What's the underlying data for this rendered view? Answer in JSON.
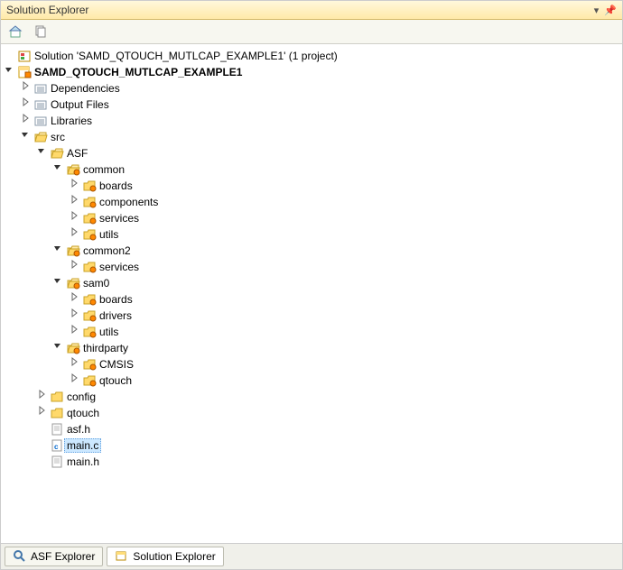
{
  "title": "Solution Explorer",
  "tabs": {
    "asf_explorer": "ASF Explorer",
    "solution_explorer": "Solution Explorer"
  },
  "tree": [
    {
      "depth": 0,
      "exp": "open",
      "icon": "solution",
      "label": "Solution 'SAMD_QTOUCH_MUTLCAP_EXAMPLE1' (1 project)",
      "bold": false,
      "sel": false,
      "hideExp": true
    },
    {
      "depth": 0,
      "exp": "open",
      "icon": "project",
      "label": "SAMD_QTOUCH_MUTLCAP_EXAMPLE1",
      "bold": true,
      "sel": false
    },
    {
      "depth": 1,
      "exp": "closed",
      "icon": "ref",
      "label": "Dependencies",
      "bold": false,
      "sel": false
    },
    {
      "depth": 1,
      "exp": "closed",
      "icon": "ref",
      "label": "Output Files",
      "bold": false,
      "sel": false
    },
    {
      "depth": 1,
      "exp": "closed",
      "icon": "ref",
      "label": "Libraries",
      "bold": false,
      "sel": false
    },
    {
      "depth": 1,
      "exp": "open",
      "icon": "folder-open",
      "label": "src",
      "bold": false,
      "sel": false
    },
    {
      "depth": 2,
      "exp": "open",
      "icon": "folder-open",
      "label": "ASF",
      "bold": false,
      "sel": false
    },
    {
      "depth": 3,
      "exp": "open",
      "icon": "folder-open-badge",
      "label": "common",
      "bold": false,
      "sel": false
    },
    {
      "depth": 4,
      "exp": "closed",
      "icon": "folder-badge",
      "label": "boards",
      "bold": false,
      "sel": false
    },
    {
      "depth": 4,
      "exp": "closed",
      "icon": "folder-badge",
      "label": "components",
      "bold": false,
      "sel": false
    },
    {
      "depth": 4,
      "exp": "closed",
      "icon": "folder-badge",
      "label": "services",
      "bold": false,
      "sel": false
    },
    {
      "depth": 4,
      "exp": "closed",
      "icon": "folder-badge",
      "label": "utils",
      "bold": false,
      "sel": false
    },
    {
      "depth": 3,
      "exp": "open",
      "icon": "folder-open-badge",
      "label": "common2",
      "bold": false,
      "sel": false
    },
    {
      "depth": 4,
      "exp": "closed",
      "icon": "folder-badge",
      "label": "services",
      "bold": false,
      "sel": false
    },
    {
      "depth": 3,
      "exp": "open",
      "icon": "folder-open-badge",
      "label": "sam0",
      "bold": false,
      "sel": false
    },
    {
      "depth": 4,
      "exp": "closed",
      "icon": "folder-badge",
      "label": "boards",
      "bold": false,
      "sel": false
    },
    {
      "depth": 4,
      "exp": "closed",
      "icon": "folder-badge",
      "label": "drivers",
      "bold": false,
      "sel": false
    },
    {
      "depth": 4,
      "exp": "closed",
      "icon": "folder-badge",
      "label": "utils",
      "bold": false,
      "sel": false
    },
    {
      "depth": 3,
      "exp": "open",
      "icon": "folder-open-badge",
      "label": "thirdparty",
      "bold": false,
      "sel": false
    },
    {
      "depth": 4,
      "exp": "closed",
      "icon": "folder-badge",
      "label": "CMSIS",
      "bold": false,
      "sel": false
    },
    {
      "depth": 4,
      "exp": "closed",
      "icon": "folder-badge",
      "label": "qtouch",
      "bold": false,
      "sel": false
    },
    {
      "depth": 2,
      "exp": "closed",
      "icon": "folder",
      "label": "config",
      "bold": false,
      "sel": false
    },
    {
      "depth": 2,
      "exp": "closed",
      "icon": "folder",
      "label": "qtouch",
      "bold": false,
      "sel": false
    },
    {
      "depth": 2,
      "exp": "none",
      "icon": "file-h",
      "label": "asf.h",
      "bold": false,
      "sel": false
    },
    {
      "depth": 2,
      "exp": "none",
      "icon": "file-c",
      "label": "main.c",
      "bold": false,
      "sel": true
    },
    {
      "depth": 2,
      "exp": "none",
      "icon": "file-h",
      "label": "main.h",
      "bold": false,
      "sel": false
    }
  ]
}
